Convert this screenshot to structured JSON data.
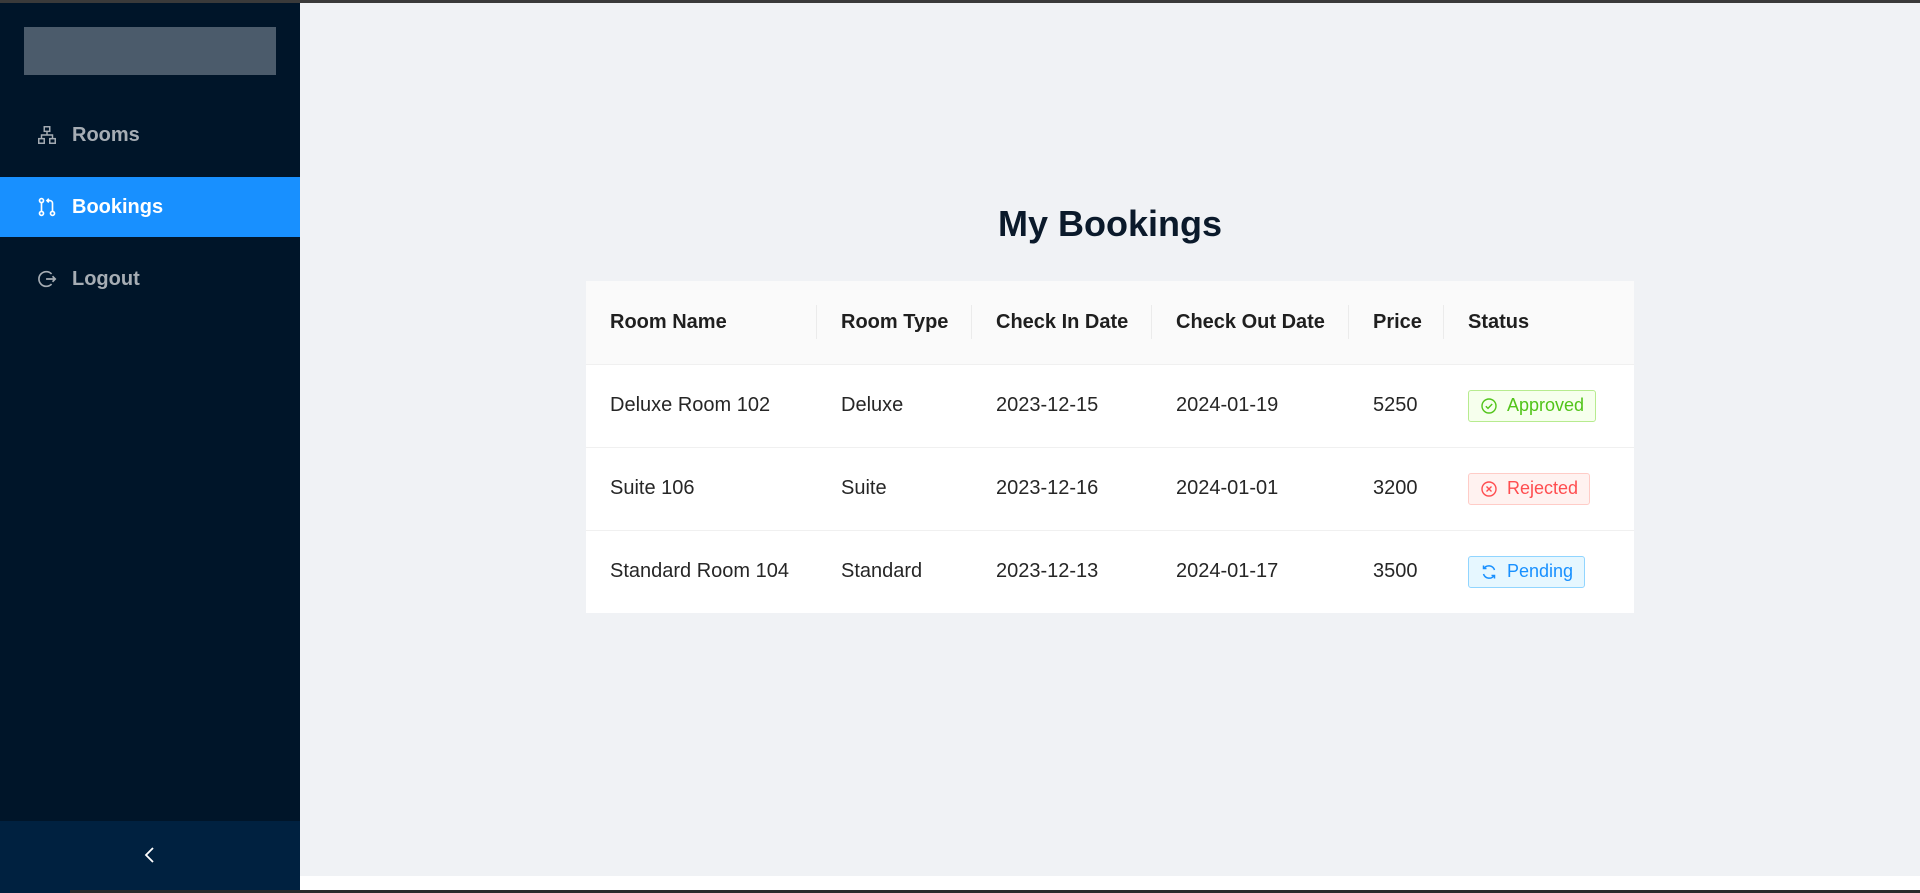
{
  "sidebar": {
    "items": [
      {
        "label": "Rooms",
        "icon": "cluster-icon",
        "active": false
      },
      {
        "label": "Bookings",
        "icon": "pull-request-icon",
        "active": true
      },
      {
        "label": "Logout",
        "icon": "logout-icon",
        "active": false
      }
    ],
    "collapse_icon": "chevron-left-icon"
  },
  "main": {
    "title": "My Bookings",
    "table": {
      "columns": [
        "Room Name",
        "Room Type",
        "Check In Date",
        "Check Out Date",
        "Price",
        "Status"
      ],
      "rows": [
        {
          "room_name": "Deluxe Room 102",
          "room_type": "Deluxe",
          "check_in": "2023-12-15",
          "check_out": "2024-01-19",
          "price": "5250",
          "status": "Approved",
          "status_icon": "check-circle-icon"
        },
        {
          "room_name": "Suite 106",
          "room_type": "Suite",
          "check_in": "2023-12-16",
          "check_out": "2024-01-01",
          "price": "3200",
          "status": "Rejected",
          "status_icon": "close-circle-icon"
        },
        {
          "room_name": "Standard Room 104",
          "room_type": "Standard",
          "check_in": "2023-12-13",
          "check_out": "2024-01-17",
          "price": "3500",
          "status": "Pending",
          "status_icon": "sync-icon"
        }
      ]
    }
  },
  "colors": {
    "sidebar_bg": "#001529",
    "active_bg": "#1890ff",
    "approved": "#52c41a",
    "rejected": "#ff4d4f",
    "pending": "#1890ff"
  }
}
